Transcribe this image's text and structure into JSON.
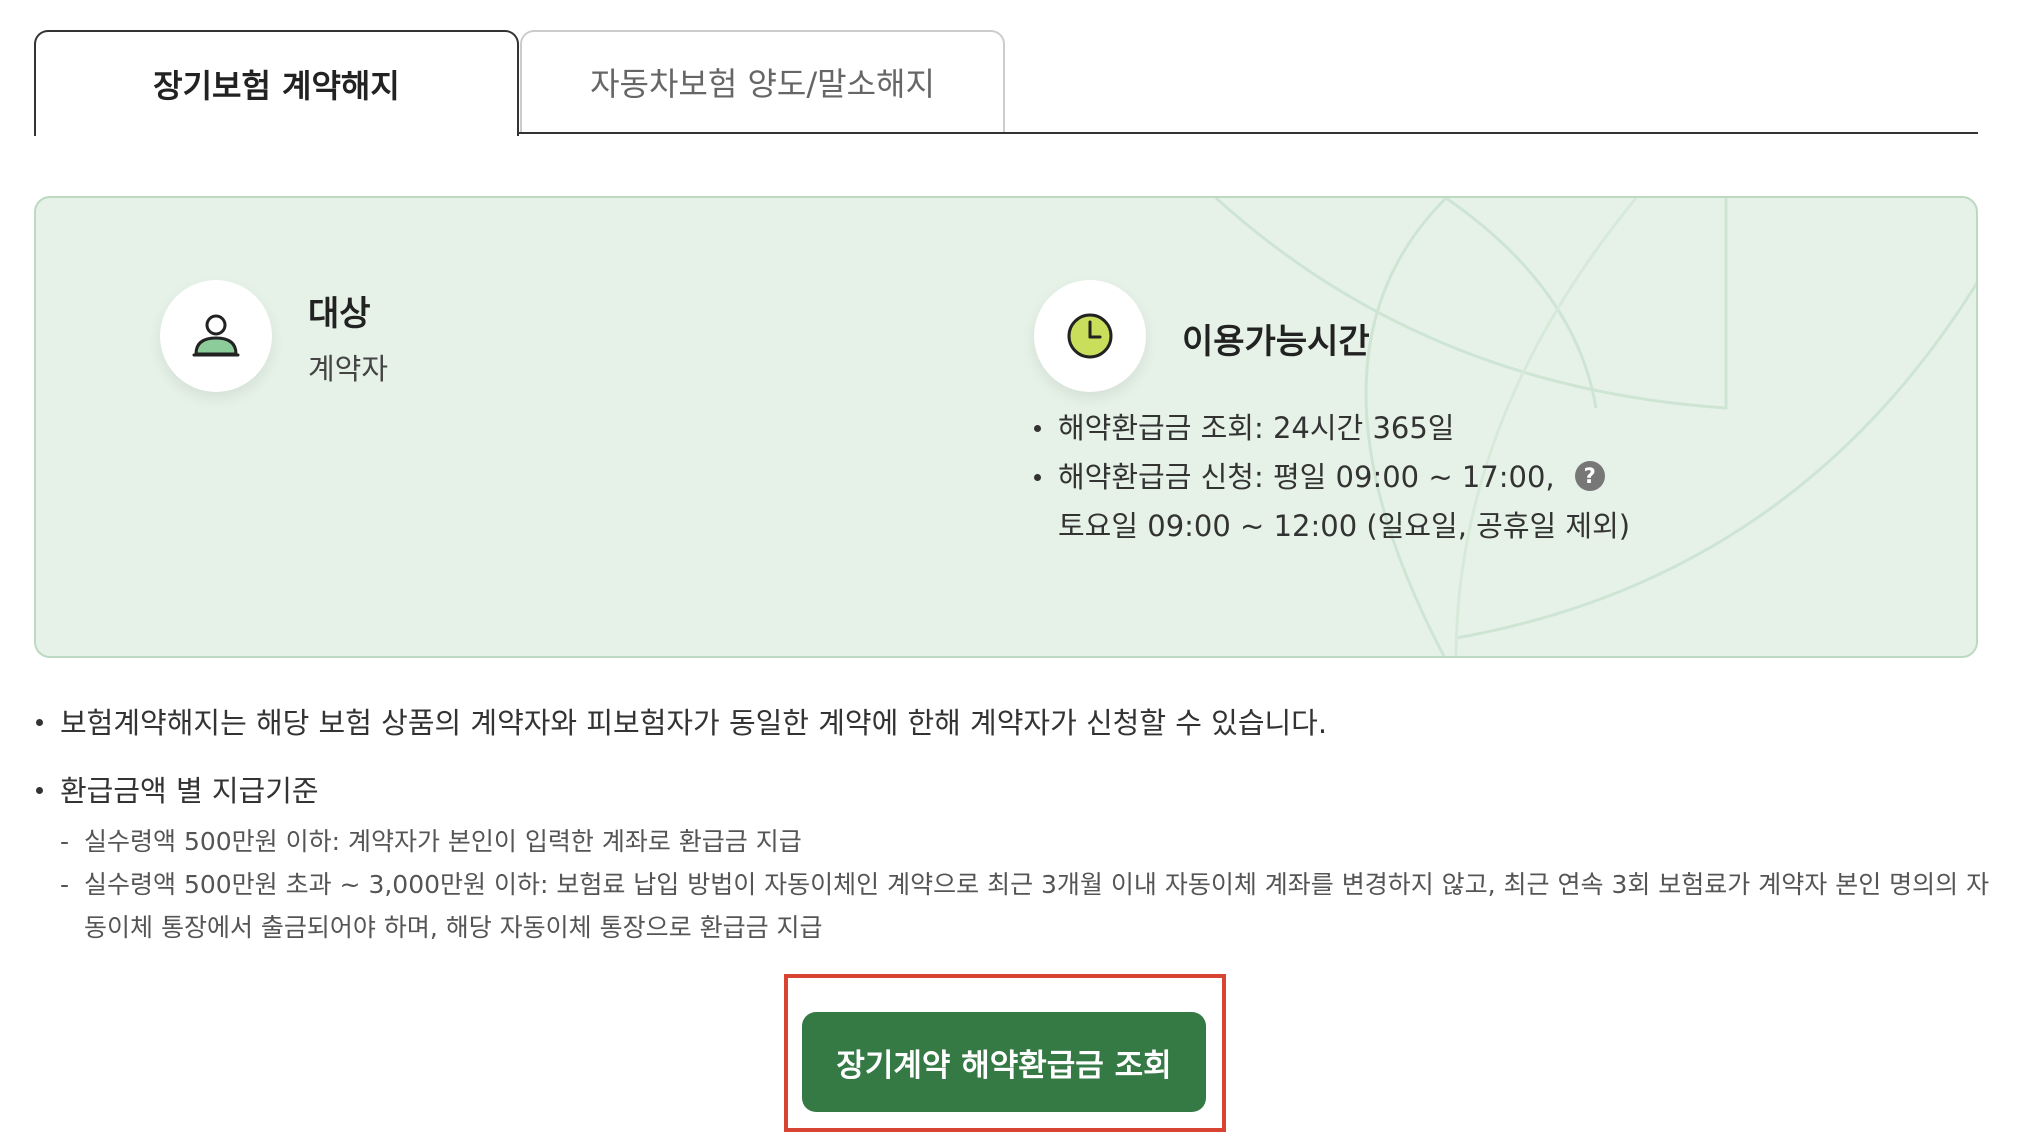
{
  "tabs": [
    {
      "label": "장기보험 계약해지",
      "active": true
    },
    {
      "label": "자동차보험 양도/말소해지",
      "active": false
    }
  ],
  "info": {
    "target": {
      "icon": "user-icon",
      "title": "대상",
      "value": "계약자"
    },
    "hours": {
      "icon": "clock-icon",
      "title": "이용가능시간",
      "items": [
        "해약환급금 조회: 24시간 365일",
        "해약환급금 신청: 평일 09:00 ~ 17:00,"
      ],
      "item2_line2": "토요일 09:00 ~ 12:00 (일요일, 공휴일 제외)",
      "help_icon_label": "?"
    }
  },
  "notes": {
    "note1": "보험계약해지는 해당 보험 상품의 계약자와 피보험자가 동일한 계약에 한해 계약자가 신청할 수 있습니다.",
    "note2": "환급금액 별 지급기준",
    "sub": [
      "실수령액 500만원 이하: 계약자가 본인이 입력한 계좌로 환급금 지급",
      "실수령액 500만원 초과 ~ 3,000만원 이하: 보험료 납입 방법이 자동이체인 계약으로 최근 3개월 이내 자동이체 계좌를 변경하지 않고, 최근 연속 3회 보험료가 계약자 본인 명의의 자동이체 통장에서 출금되어야 하며, 해당 자동이체 통장으로 환급금 지급"
    ]
  },
  "cta": {
    "label": "장기계약 해약환급금 조회"
  },
  "colors": {
    "panel_bg": "#e6f2e8",
    "panel_border": "#bcd9c2",
    "button_green": "#357a45",
    "highlight_red": "#d84431",
    "icon_green": "#8ccc9a",
    "clock_face": "#c9de5a"
  }
}
